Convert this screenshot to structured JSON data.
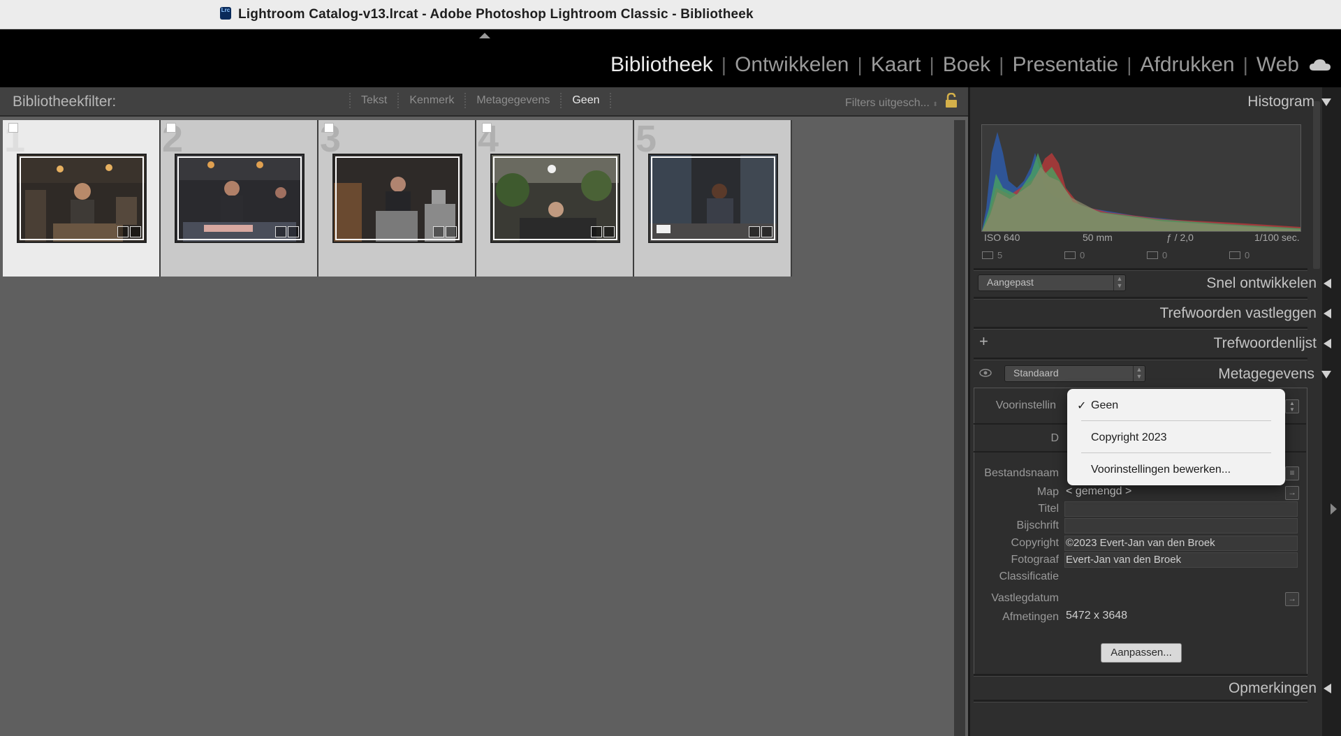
{
  "window": {
    "title": "Lightroom Catalog-v13.lrcat - Adobe Photoshop Lightroom Classic - Bibliotheek",
    "app_icon": "Lrc"
  },
  "modules": [
    {
      "label": "Bibliotheek",
      "active": true
    },
    {
      "label": "Ontwikkelen",
      "active": false
    },
    {
      "label": "Kaart",
      "active": false
    },
    {
      "label": "Boek",
      "active": false
    },
    {
      "label": "Presentatie",
      "active": false
    },
    {
      "label": "Afdrukken",
      "active": false
    },
    {
      "label": "Web",
      "active": false
    }
  ],
  "filterbar": {
    "label": "Bibliotheekfilter:",
    "tabs": [
      "Tekst",
      "Kenmerk",
      "Metagegevens",
      "Geen"
    ],
    "active_tab": "Geen",
    "presets": "Filters uitgesch..."
  },
  "grid": {
    "cells": [
      {
        "number": "1",
        "selected": true
      },
      {
        "number": "2",
        "selected": false
      },
      {
        "number": "3",
        "selected": false
      },
      {
        "number": "4",
        "selected": false
      },
      {
        "number": "5",
        "selected": false
      }
    ]
  },
  "histogram": {
    "title": "Histogram",
    "iso": "ISO 640",
    "focal": "50 mm",
    "aperture": "ƒ / 2,0",
    "shutter": "1/100 sec.",
    "counts": [
      "5",
      "0",
      "0",
      "0"
    ]
  },
  "quick_develop": {
    "title": "Snel ontwikkelen",
    "preset": "Aangepast"
  },
  "keywording": {
    "title": "Trefwoorden vastleggen"
  },
  "keyword_list": {
    "title": "Trefwoordenlijst",
    "add": "+"
  },
  "metadata": {
    "title": "Metagegevens",
    "view": "Standaard",
    "preset_label": "Voorinstellin",
    "d_label": "D",
    "rows": {
      "filename": "Bestandsnaam",
      "folder": "Map",
      "folder_value": "< gemengd >",
      "title": "Titel",
      "caption": "Bijschrift",
      "copyright": "Copyright",
      "copyright_value": "©2023 Evert-Jan van den Broek",
      "creator": "Fotograaf",
      "creator_value": "Evert-Jan van den Broek",
      "rating": "Classificatie",
      "capture_date": "Vastlegdatum",
      "dimensions": "Afmetingen",
      "dimensions_value": "5472 x 3648"
    },
    "customize": "Aanpassen..."
  },
  "comments": {
    "title": "Opmerkingen"
  },
  "popup": {
    "check": "✓",
    "items": [
      "Geen",
      "Copyright 2023",
      "Voorinstellingen bewerken..."
    ]
  }
}
